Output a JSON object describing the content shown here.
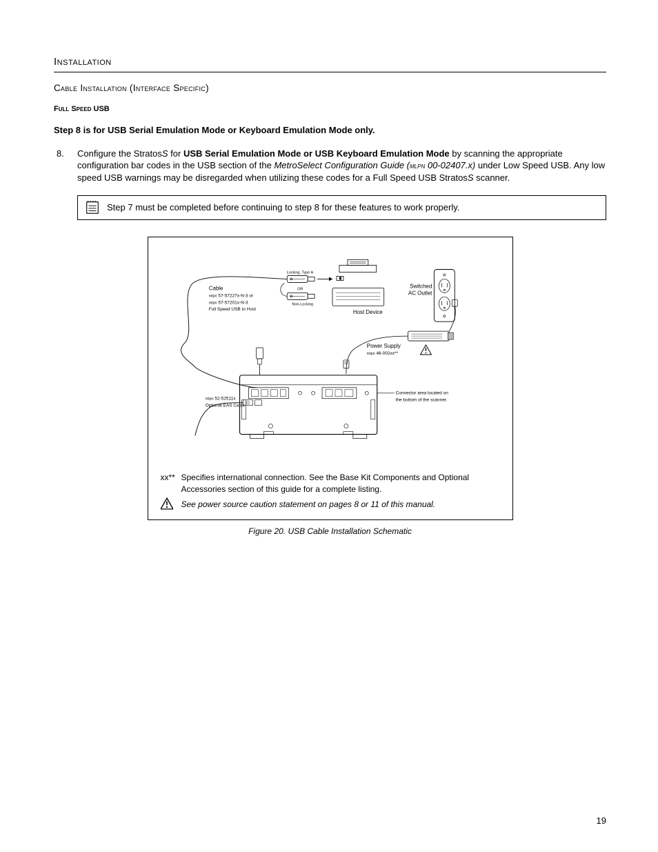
{
  "section": "Installation",
  "subsection": "Cable Installation (Interface Specific)",
  "mini_header": "Full Speed USB",
  "step_note": "Step 8 is for USB Serial Emulation Mode or Keyboard Emulation Mode only.",
  "step": {
    "number": "8.",
    "pre": "Configure the Stratos",
    "product_suffix": "S",
    "mid1": " for ",
    "bold": "USB Serial Emulation Mode or USB Keyboard Emulation Mode",
    "mid2": " by scanning the appropriate configuration bar codes in the USB section of the ",
    "guide": "MetroSelect Configuration Guide (",
    "mlpn_sc": "mlpn",
    "guide_num": " 00-02407.x)",
    "tail": " under Low Speed USB. Any low speed USB warnings may be disregarded when utilizing these codes for a Full Speed USB Stratos",
    "product_suffix2": "S",
    "tail2": " scanner."
  },
  "note_box": "Step 7 must be completed before continuing to step 8 for these features to work properly.",
  "schematic": {
    "locking": "Locking, Type A",
    "or": "OR",
    "nonlocking": "Non-Locking",
    "cable_title": "Cable",
    "cable_l1_sc": "mlpn",
    "cable_l1": " 57-57227x-N-3 or",
    "cable_l2_sc": "mlpn",
    "cable_l2": " 57-57201x-N-3",
    "cable_l3": "Full Speed USB to Host",
    "host": "Host Device",
    "switched": "Switched",
    "ac_outlet": "AC Outlet",
    "power_supply": "Power Supply",
    "ps_sc": "mlpn",
    "ps_num": " 46-002xx**",
    "eas_sc": "mlpn",
    "eas_num": " 52-52511x",
    "eas_label": "Optional EAS Cable",
    "connector_l1": "Connector area located on",
    "connector_l2": "the bottom of the scanner."
  },
  "fig_footer": {
    "marker": "xx**",
    "line1": "Specifies international connection.  See the Base Kit Components and Optional Accessories section of this guide for a complete listing.",
    "line2": "See power source caution statement on pages 8 or 11 of this manual."
  },
  "fig_caption": "Figure 20. USB Cable Installation Schematic",
  "page_number": "19"
}
